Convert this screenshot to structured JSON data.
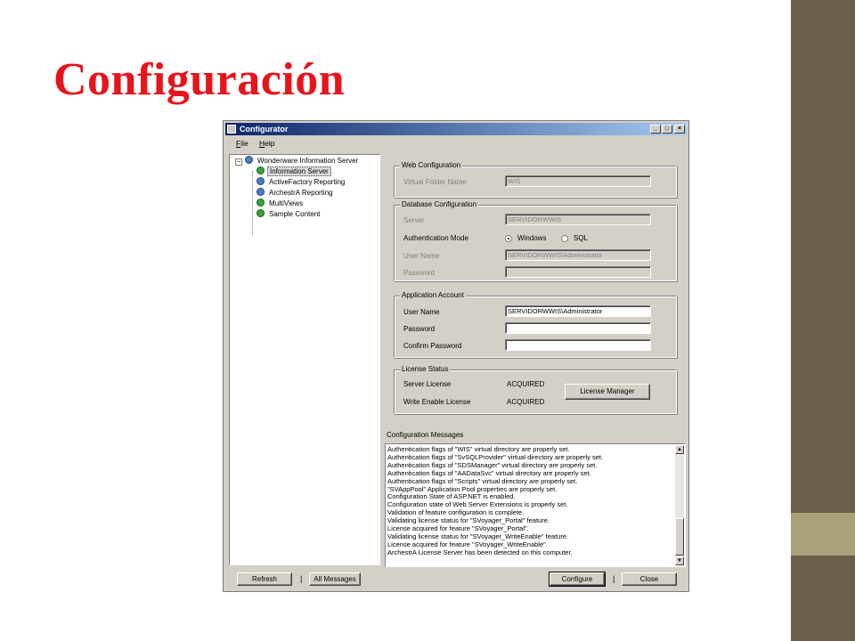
{
  "slide": {
    "title": "Configuración"
  },
  "window": {
    "title": "Configurator",
    "controls": {
      "minimize": "_",
      "maximize": "□",
      "close": "×"
    },
    "menu": [
      {
        "accel": "F",
        "rest": "ile"
      },
      {
        "accel": "H",
        "rest": "elp"
      }
    ]
  },
  "tree": {
    "expander": "−",
    "root": {
      "label": "Wonderware Information Server",
      "icon": "info-node-icon"
    },
    "children": [
      {
        "label": "Information Server",
        "icon": "check-icon",
        "status": "green"
      },
      {
        "label": "ActiveFactory Reporting",
        "icon": "info-node-icon",
        "status": "blue"
      },
      {
        "label": "ArchestrA Reporting",
        "icon": "info-node-icon",
        "status": "blue"
      },
      {
        "label": "MultiViews",
        "icon": "check-icon",
        "status": "green"
      },
      {
        "label": "Sample Content",
        "icon": "check-icon",
        "status": "green"
      }
    ]
  },
  "web_config": {
    "legend": "Web Configuration",
    "virtual_folder_label": "Virtual Folder Name",
    "virtual_folder_value": "WIS"
  },
  "db_config": {
    "legend": "Database Configuration",
    "server_label": "Server",
    "server_value": "SERVIDORWWIS",
    "auth_mode_label": "Authentication Mode",
    "auth_windows": "Windows",
    "auth_sql": "SQL",
    "auth_selected": "Windows",
    "user_label": "User Name",
    "user_value": "SERVIDORWWIS\\Administrator",
    "password_label": "Password",
    "password_value": ""
  },
  "app_account": {
    "legend": "Application Account",
    "user_label": "User Name",
    "user_value": "SERVIDORWWIS\\Administrator",
    "password_label": "Password",
    "confirm_label": "Confirm Password"
  },
  "license": {
    "legend": "License Status",
    "server_label": "Server License",
    "server_value": "ACQUIRED",
    "write_label": "Write Enable License",
    "write_value": "ACQUIRED",
    "manager_button": "License Manager"
  },
  "messages": {
    "heading": "Configuration Messages",
    "lines": [
      "Authentication flags of \"WIS\" virtual directory are properly set.",
      "Authentication flags of \"SvSQLProvider\" virtual directory are properly set.",
      "Authentication flags of \"SDSManager\" virtual directory are properly set.",
      "Authentication flags of \"AADataSvc\" virtual directory are properly set.",
      "Authentication flags of \"Scripts\" virtual directory are properly set.",
      "\"SVAppPool\" Application Pool properties are properly set.",
      "Configuration State of ASP.NET is enabled.",
      "Configuration state of Web Server Extensions is properly set.",
      "Validation of feature configuration is complete.",
      "Validating license status for \"SVoyager_Portal\" feature.",
      "License acquired for feature \"SVoyager_Portal\".",
      "Validating license status for \"SVoyager_WriteEnable\" feature.",
      "License acquired for feature \"SVoyager_WriteEnable\".",
      "ArchestrA License Server has been detected on this computer."
    ]
  },
  "footer": {
    "refresh": "Refresh",
    "all_messages": "All Messages",
    "configure": "Configure",
    "close": "Close",
    "separator": "|"
  }
}
